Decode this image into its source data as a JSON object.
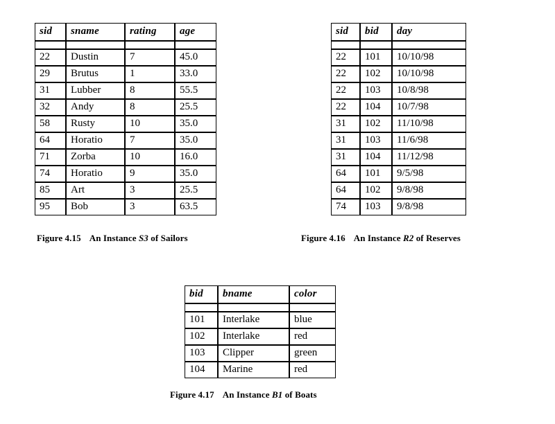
{
  "figures": [
    {
      "id": "sailors",
      "caption": {
        "number": "Figure 4.15",
        "text_before": "An Instance ",
        "relation": "S3",
        "text_after": " of Sailors"
      },
      "table": {
        "columns": [
          "sid",
          "sname",
          "rating",
          "age"
        ],
        "rows": [
          [
            "22",
            "Dustin",
            "7",
            "45.0"
          ],
          [
            "29",
            "Brutus",
            "1",
            "33.0"
          ],
          [
            "31",
            "Lubber",
            "8",
            "55.5"
          ],
          [
            "32",
            "Andy",
            "8",
            "25.5"
          ],
          [
            "58",
            "Rusty",
            "10",
            "35.0"
          ],
          [
            "64",
            "Horatio",
            "7",
            "35.0"
          ],
          [
            "71",
            "Zorba",
            "10",
            "16.0"
          ],
          [
            "74",
            "Horatio",
            "9",
            "35.0"
          ],
          [
            "85",
            "Art",
            "3",
            "25.5"
          ],
          [
            "95",
            "Bob",
            "3",
            "63.5"
          ]
        ]
      }
    },
    {
      "id": "reserves",
      "caption": {
        "number": "Figure 4.16",
        "text_before": "An Instance ",
        "relation": "R2",
        "text_after": " of Reserves"
      },
      "table": {
        "columns": [
          "sid",
          "bid",
          "day"
        ],
        "rows": [
          [
            "22",
            "101",
            "10/10/98"
          ],
          [
            "22",
            "102",
            "10/10/98"
          ],
          [
            "22",
            "103",
            "10/8/98"
          ],
          [
            "22",
            "104",
            "10/7/98"
          ],
          [
            "31",
            "102",
            "11/10/98"
          ],
          [
            "31",
            "103",
            "11/6/98"
          ],
          [
            "31",
            "104",
            "11/12/98"
          ],
          [
            "64",
            "101",
            "9/5/98"
          ],
          [
            "64",
            "102",
            "9/8/98"
          ],
          [
            "74",
            "103",
            "9/8/98"
          ]
        ]
      }
    },
    {
      "id": "boats",
      "caption": {
        "number": "Figure 4.17",
        "text_before": "An Instance ",
        "relation": "B1",
        "text_after": " of Boats"
      },
      "table": {
        "columns": [
          "bid",
          "bname",
          "color"
        ],
        "rows": [
          [
            "101",
            "Interlake",
            "blue"
          ],
          [
            "102",
            "Interlake",
            "red"
          ],
          [
            "103",
            "Clipper",
            "green"
          ],
          [
            "104",
            "Marine",
            "red"
          ]
        ]
      }
    }
  ],
  "style": {
    "page_background": "#ffffff",
    "text_color": "#000000",
    "rule_color": "#000000"
  }
}
